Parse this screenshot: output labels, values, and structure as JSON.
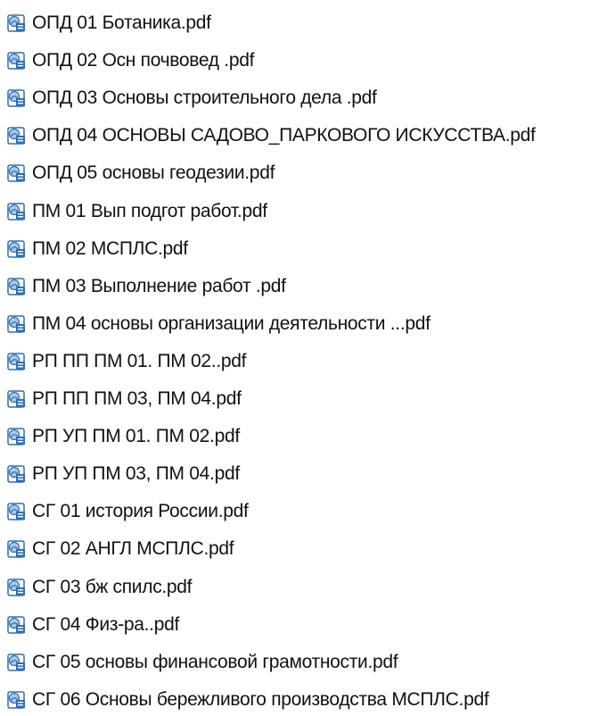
{
  "files": [
    {
      "name": "ОПД 01 Ботаника.pdf",
      "icon": "pdf-file-icon"
    },
    {
      "name": "ОПД 02 Осн почвовед .pdf",
      "icon": "pdf-file-icon"
    },
    {
      "name": "ОПД 03 Основы строительного дела .pdf",
      "icon": "pdf-file-icon"
    },
    {
      "name": "ОПД 04 ОСНОВЫ САДОВО_ПАРКОВОГО ИСКУССТВА.pdf",
      "icon": "pdf-file-icon"
    },
    {
      "name": "ОПД 05 основы геодезии.pdf",
      "icon": "pdf-file-icon"
    },
    {
      "name": "ПМ 01 Вып подгот работ.pdf",
      "icon": "pdf-file-icon"
    },
    {
      "name": "ПМ 02 МСПЛС.pdf",
      "icon": "pdf-file-icon"
    },
    {
      "name": "ПМ 03 Выполнение работ  .pdf",
      "icon": "pdf-file-icon"
    },
    {
      "name": "ПМ 04 основы организации деятельности ...pdf",
      "icon": "pdf-file-icon"
    },
    {
      "name": "РП ПП ПМ 01. ПМ 02..pdf",
      "icon": "pdf-file-icon"
    },
    {
      "name": "РП ПП ПМ 03, ПМ 04.pdf",
      "icon": "pdf-file-icon"
    },
    {
      "name": "РП УП ПМ 01.  ПМ 02.pdf",
      "icon": "pdf-file-icon"
    },
    {
      "name": "РП УП ПМ 03, ПМ 04.pdf",
      "icon": "pdf-file-icon"
    },
    {
      "name": "СГ 01 история России.pdf",
      "icon": "pdf-file-icon"
    },
    {
      "name": "СГ 02 АНГЛ МСПЛС.pdf",
      "icon": "pdf-file-icon"
    },
    {
      "name": "СГ 03 бж спилс.pdf",
      "icon": "pdf-file-icon"
    },
    {
      "name": "СГ 04  Физ-ра..pdf",
      "icon": "pdf-file-icon"
    },
    {
      "name": "СГ 05  основы финансовой грамотности.pdf",
      "icon": "pdf-file-icon"
    },
    {
      "name": "СГ 06 Основы бережливого производства МСПЛС.pdf",
      "icon": "pdf-file-icon"
    }
  ],
  "colors": {
    "text": "#111111",
    "icon_blue": "#2f6fb0",
    "icon_light": "#a9c9ea"
  }
}
